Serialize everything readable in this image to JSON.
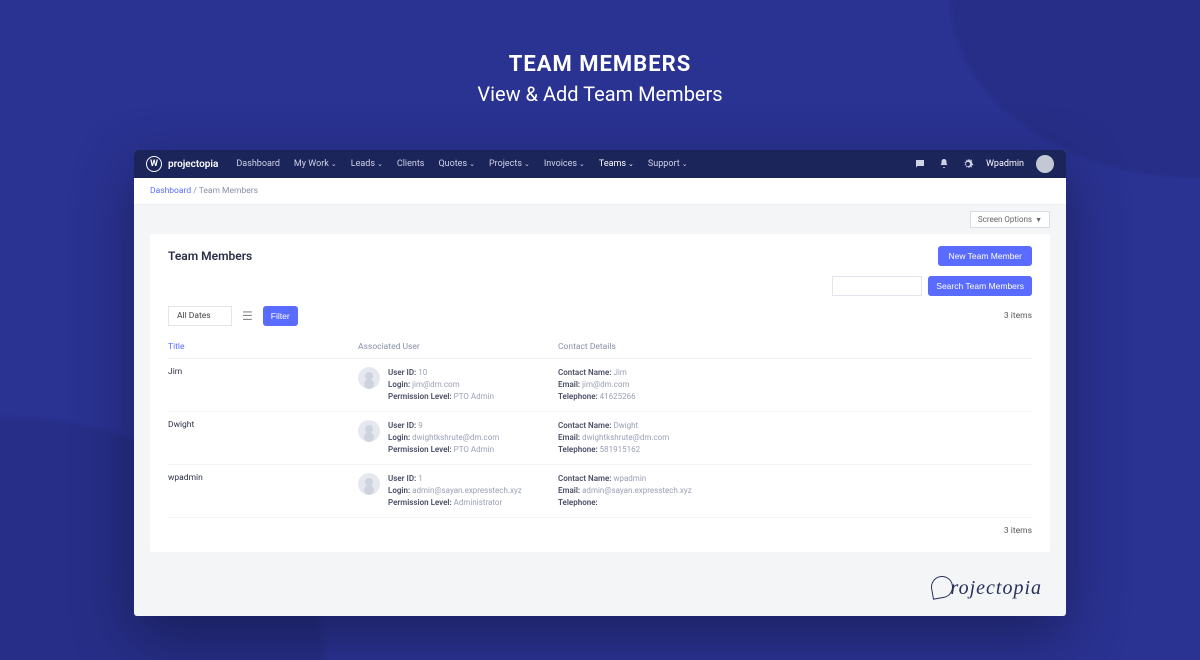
{
  "hero": {
    "title": "TEAM MEMBERS",
    "subtitle": "View & Add Team Members"
  },
  "brand": "projectopia",
  "nav": {
    "items": [
      {
        "label": "Dashboard",
        "dropdown": false
      },
      {
        "label": "My Work",
        "dropdown": true
      },
      {
        "label": "Leads",
        "dropdown": true
      },
      {
        "label": "Clients",
        "dropdown": false
      },
      {
        "label": "Quotes",
        "dropdown": true
      },
      {
        "label": "Projects",
        "dropdown": true
      },
      {
        "label": "Invoices",
        "dropdown": true
      },
      {
        "label": "Teams",
        "dropdown": true,
        "active": true
      },
      {
        "label": "Support",
        "dropdown": true
      }
    ]
  },
  "topbar_right": {
    "username": "Wpadmin"
  },
  "breadcrumb": {
    "root": "Dashboard",
    "sep": "/",
    "current": "Team Members"
  },
  "screen_options": "Screen Options",
  "panel": {
    "title": "Team Members",
    "new_button": "New Team Member",
    "search_button": "Search Team Members",
    "all_dates": "All Dates",
    "filter": "Filter",
    "count": "3 items",
    "columns": {
      "title": "Title",
      "user": "Associated User",
      "contact": "Contact Details"
    }
  },
  "rows": [
    {
      "title": "Jim",
      "user": {
        "id_label": "User ID:",
        "id": "10",
        "login_label": "Login:",
        "login": "jim@dm.com",
        "perm_label": "Permission Level:",
        "perm": "PTO Admin"
      },
      "contact": {
        "name_label": "Contact Name:",
        "name": "Jim",
        "email_label": "Email:",
        "email": "jim@dm.com",
        "tel_label": "Telephone:",
        "tel": "41625266"
      }
    },
    {
      "title": "Dwight",
      "user": {
        "id_label": "User ID:",
        "id": "9",
        "login_label": "Login:",
        "login": "dwightkshrute@dm.com",
        "perm_label": "Permission Level:",
        "perm": "PTO Admin"
      },
      "contact": {
        "name_label": "Contact Name:",
        "name": "Dwight",
        "email_label": "Email:",
        "email": "dwightkshrute@dm.com",
        "tel_label": "Telephone:",
        "tel": "581915162"
      }
    },
    {
      "title": "wpadmin",
      "user": {
        "id_label": "User ID:",
        "id": "1",
        "login_label": "Login:",
        "login": "admin@sayan.expresstech.xyz",
        "perm_label": "Permission Level:",
        "perm": "Administrator"
      },
      "contact": {
        "name_label": "Contact Name:",
        "name": "wpadmin",
        "email_label": "Email:",
        "email": "admin@sayan.expresstech.xyz",
        "tel_label": "Telephone:",
        "tel": ""
      }
    }
  ],
  "footer_brand": "rojectopia"
}
